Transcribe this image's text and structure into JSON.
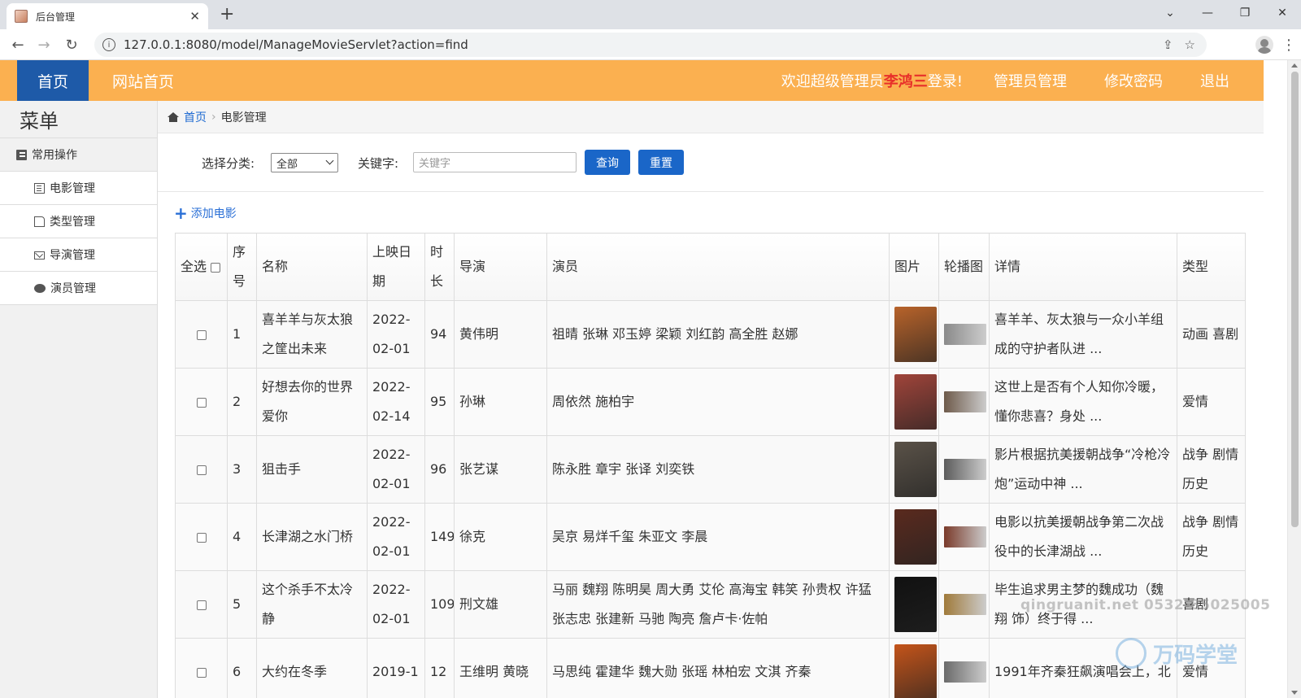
{
  "browser": {
    "tab_title": "后台管理",
    "url": "127.0.0.1:8080/model/ManageMovieServlet?action=find"
  },
  "header": {
    "home": "首页",
    "site_home": "网站首页",
    "welcome_prefix": "欢迎超级管理员",
    "admin_name": "李鸿三",
    "welcome_suffix": "登录!",
    "admin_manage": "管理员管理",
    "change_password": "修改密码",
    "logout": "退出",
    "colors": {
      "bar": "#fbb050",
      "active": "#1e5aa8",
      "admin": "#e8302a"
    }
  },
  "sidebar": {
    "title": "菜单",
    "group": "常用操作",
    "items": [
      {
        "label": "电影管理",
        "icon": "list-icon"
      },
      {
        "label": "类型管理",
        "icon": "file-icon"
      },
      {
        "label": "导演管理",
        "icon": "envelope-icon"
      },
      {
        "label": "演员管理",
        "icon": "comment-icon"
      }
    ]
  },
  "breadcrumb": {
    "home": "首页",
    "current": "电影管理"
  },
  "search": {
    "category_label": "选择分类:",
    "category_value": "全部",
    "keyword_label": "关键字:",
    "keyword_placeholder": "关键字",
    "query_button": "查询",
    "reset_button": "重置"
  },
  "add_movie": "添加电影",
  "table": {
    "headers": {
      "select_all": "全选",
      "index": "序号",
      "name": "名称",
      "release": "上映日期",
      "duration": "时长",
      "director": "导演",
      "actors": "演员",
      "poster": "图片",
      "carousel": "轮播图",
      "detail": "详情",
      "genre": "类型"
    },
    "rows": [
      {
        "index": "1",
        "name": "喜羊羊与灰太狼之筐出未来",
        "release": "2022-02-01",
        "duration": "94",
        "director": "黄伟明",
        "actors": "祖晴 张琳 邓玉婷 梁颖 刘红韵 高全胜 赵娜",
        "detail": "喜羊羊、灰太狼与一众小羊组成的守护者队进 ...",
        "genre": "动画 喜剧",
        "poster_color": "#b8632a",
        "banner_color": "#8a8a8a"
      },
      {
        "index": "2",
        "name": "好想去你的世界爱你",
        "release": "2022-02-14",
        "duration": "95",
        "director": "孙琳",
        "actors": "周依然 施柏宇",
        "detail": "这世上是否有个人知你冷暖，懂你悲喜？身处 ...",
        "genre": "爱情",
        "poster_color": "#a0443a",
        "banner_color": "#6e5a4a"
      },
      {
        "index": "3",
        "name": "狙击手",
        "release": "2022-02-01",
        "duration": "96",
        "director": "张艺谋",
        "actors": "陈永胜 章宇 张译 刘奕铁",
        "detail": "影片根据抗美援朝战争“冷枪冷炮”运动中神 ...",
        "genre": "战争 剧情 历史",
        "poster_color": "#5a5248",
        "banner_color": "#5c5c5c"
      },
      {
        "index": "4",
        "name": "长津湖之水门桥",
        "release": "2022-02-01",
        "duration": "149",
        "director": "徐克",
        "actors": "吴京 易烊千玺 朱亚文 李晨",
        "detail": "电影以抗美援朝战争第二次战役中的长津湖战 ...",
        "genre": "战争 剧情 历史",
        "poster_color": "#5a2a1e",
        "banner_color": "#7a3a2a"
      },
      {
        "index": "5",
        "name": "这个杀手不太冷静",
        "release": "2022-02-01",
        "duration": "109",
        "director": "刑文雄",
        "actors": "马丽 魏翔 陈明昊 周大勇 艾伦 高海宝 韩笑 孙贵权 许猛 张志忠 张建新 马驰 陶亮 詹卢卡·佐帕",
        "detail": "毕生追求男主梦的魏成功（魏翔 饰）终于得 ...",
        "genre": "喜剧",
        "poster_color": "#111111",
        "banner_color": "#a07a3a"
      },
      {
        "index": "6",
        "name": "大约在冬季",
        "release": "2019-1",
        "duration": "12",
        "director": "王维明 黄晓",
        "actors": "马思纯 霍建华 魏大勋 张瑶 林柏宏 文淇 齐秦",
        "detail": "1991年齐秦狂飙演唱会上，北",
        "genre": "爱情",
        "poster_color": "#c4541a",
        "banner_color": "#6a6a6a"
      }
    ]
  },
  "watermark": {
    "text": "qingruanit.net 0532-85025005",
    "logo": "万码学堂"
  }
}
